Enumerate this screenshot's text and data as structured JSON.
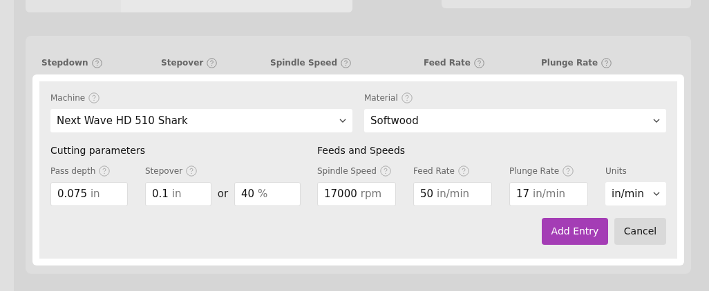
{
  "background": {
    "columns": [
      "Stepdown",
      "Stepover",
      "Spindle Speed",
      "Feed Rate",
      "Plunge Rate"
    ]
  },
  "dialog": {
    "machine": {
      "label": "Machine",
      "value": "Next Wave HD 510 Shark"
    },
    "material": {
      "label": "Material",
      "value": "Softwood"
    },
    "cutting": {
      "title": "Cutting parameters",
      "pass_depth": {
        "label": "Pass depth",
        "value": "0.075",
        "unit": "in"
      },
      "stepover": {
        "label": "Stepover",
        "value": "0.1",
        "unit": "in",
        "separator": "or",
        "percent_value": "40",
        "percent_unit": "%"
      }
    },
    "feeds": {
      "title": "Feeds and Speeds",
      "fields": [
        {
          "label": "Spindle Speed",
          "value": "17000",
          "unit": "rpm"
        },
        {
          "label": "Feed Rate",
          "value": "50",
          "unit": "in/min"
        },
        {
          "label": "Plunge Rate",
          "value": "17",
          "unit": "in/min"
        }
      ],
      "units": {
        "label": "Units",
        "value": "in/min"
      }
    },
    "buttons": [
      {
        "kind": "primary",
        "label": "Add Entry"
      },
      {
        "kind": "secondary",
        "label": "Cancel"
      }
    ]
  }
}
